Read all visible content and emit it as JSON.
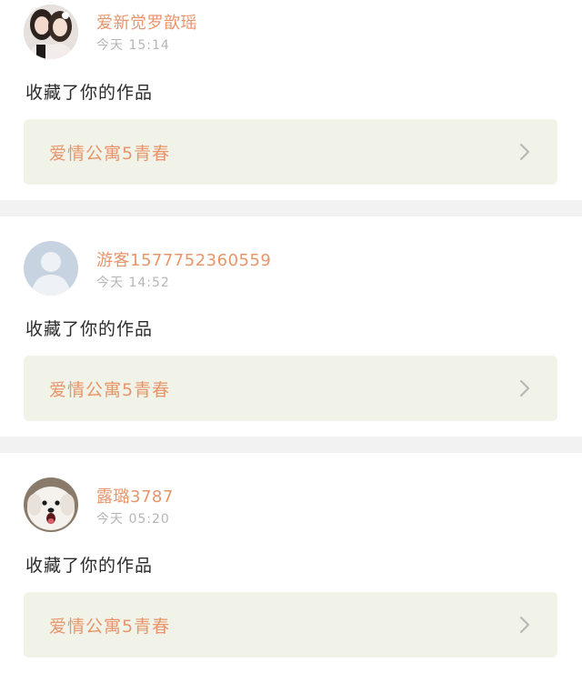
{
  "notifications": [
    {
      "user_name": "爱新觉罗歆瑶",
      "time": "今天 15:14",
      "action": "收藏了你的作品",
      "work_title": "爱情公寓5青春",
      "avatar_icon": "two-girls-photo-avatar"
    },
    {
      "user_name": "游客15777523605​59",
      "time": "今天 14:52",
      "action": "收藏了你的作品",
      "work_title": "爱情公寓5青春",
      "avatar_icon": "default-person-avatar"
    },
    {
      "user_name": "露璐3787",
      "time": "今天 05:20",
      "action": "收藏了你的作品",
      "work_title": "爱情公寓5青春",
      "avatar_icon": "white-dog-photo-avatar"
    }
  ],
  "colors": {
    "accent": "#e8956a",
    "time": "#b5b5b5",
    "link_bg": "#f1f3e8",
    "divider": "#f2f2f2",
    "chevron": "#b8b8b8"
  }
}
